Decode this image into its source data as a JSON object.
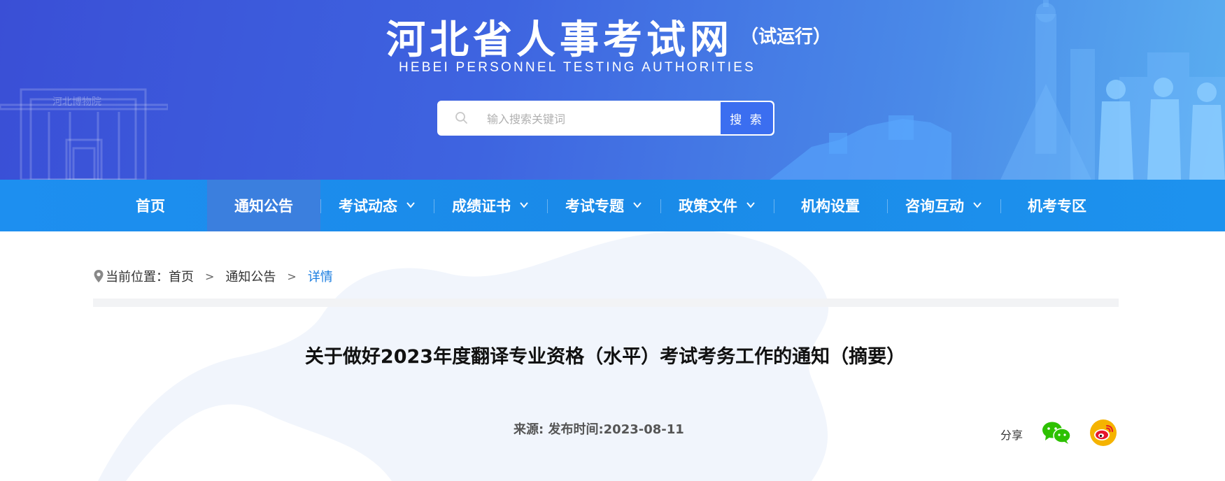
{
  "header": {
    "title": "河北省人事考试网",
    "title_suffix": "（试运行）",
    "subtitle": "HEBEI  PERSONNEL  TESTING AUTHORITIES",
    "building_sign": "河北博物院"
  },
  "search": {
    "placeholder": "输入搜索关键词",
    "value": "",
    "button_label": "搜 索",
    "icon": "search-icon"
  },
  "nav": {
    "items": [
      {
        "label": "首页",
        "has_dropdown": false,
        "active": false
      },
      {
        "label": "通知公告",
        "has_dropdown": false,
        "active": true
      },
      {
        "label": "考试动态",
        "has_dropdown": true,
        "active": false
      },
      {
        "label": "成绩证书",
        "has_dropdown": true,
        "active": false
      },
      {
        "label": "考试专题",
        "has_dropdown": true,
        "active": false
      },
      {
        "label": "政策文件",
        "has_dropdown": true,
        "active": false
      },
      {
        "label": "机构设置",
        "has_dropdown": false,
        "active": false
      },
      {
        "label": "咨询互动",
        "has_dropdown": true,
        "active": false
      },
      {
        "label": "机考专区",
        "has_dropdown": false,
        "active": false
      }
    ]
  },
  "breadcrumb": {
    "prefix": "当前位置：",
    "items": [
      "首页",
      "通知公告",
      "详情"
    ],
    "separator": ">"
  },
  "article": {
    "title": "关于做好2023年度翻译专业资格（水平）考试考务工作的通知（摘要）",
    "meta": "来源:  发布时间:2023-08-11"
  },
  "share": {
    "label": "分享",
    "icons": [
      "wechat-icon",
      "weibo-icon"
    ]
  },
  "colors": {
    "banner_start": "#3a4fd6",
    "banner_end": "#5aaef0",
    "nav": "#1a8ae8",
    "nav_active": "#3b7fde",
    "breadcrumb_current": "#1a7de0",
    "wechat": "#2dc100",
    "weibo": "#e6162d"
  }
}
